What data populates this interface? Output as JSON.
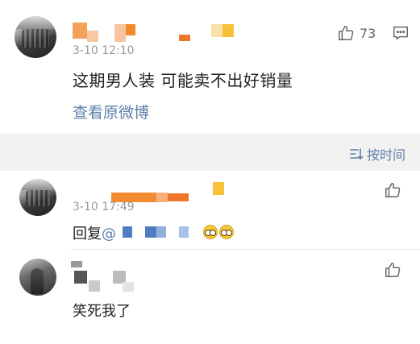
{
  "post": {
    "timestamp": "3-10 12:10",
    "text": "这期男人装 可能卖不出好销量",
    "view_original_link": "查看原微博",
    "like_count": "73"
  },
  "sort": {
    "label": "按时间"
  },
  "comments": [
    {
      "timestamp": "3-10 17:49",
      "reply_prefix": "回复",
      "at_symbol": "@",
      "text": ""
    },
    {
      "timestamp": "",
      "text": "笑死我了"
    }
  ],
  "icons": {
    "like": "thumbs-up-icon",
    "comment": "comment-icon",
    "sort": "sort-icon",
    "emoji": "emoji-icon"
  },
  "colors": {
    "link": "#5d7fa8",
    "redaction_orange": "#f28a30",
    "redaction_yellow": "#f7c23a",
    "redaction_blue": "#4f7ec0"
  }
}
